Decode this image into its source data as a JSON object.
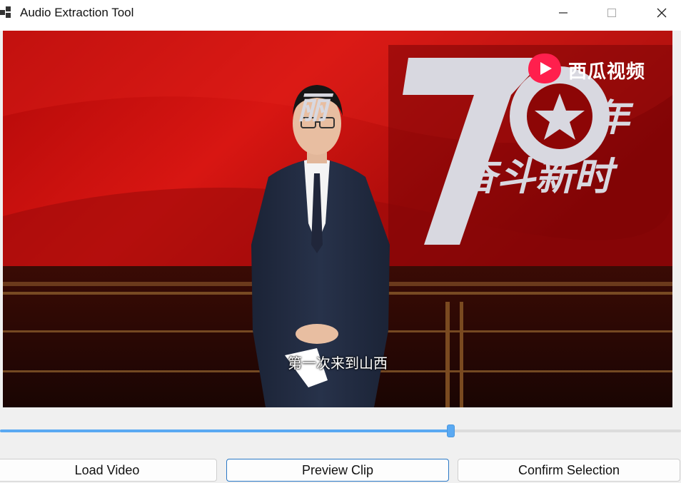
{
  "window": {
    "title": "Audio Extraction Tool",
    "icons": {
      "app": "app-icon",
      "minimize": "minimize-icon",
      "maximize": "maximize-icon",
      "close": "close-icon"
    }
  },
  "video": {
    "subtitle": "第一次来到山西",
    "watermark": {
      "text": "西瓜视频",
      "icon": "xigua-play-icon"
    },
    "stage_text": {
      "left": "丽",
      "number": "70",
      "year": "年",
      "slogan": "奋斗新时"
    }
  },
  "timeline": {
    "progress": 0.662
  },
  "buttons": {
    "load": "Load Video",
    "preview": "Preview Clip",
    "confirm": "Confirm Selection"
  },
  "colors": {
    "accent": "#5aa9f2",
    "focus_border": "#2a78c6",
    "stage_red": "#c0100e"
  }
}
